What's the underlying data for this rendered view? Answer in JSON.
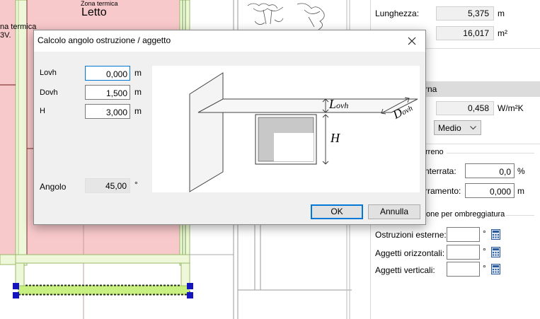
{
  "cad": {
    "zone_label": "Zona termica",
    "room_name": "Letto",
    "left_text_1": "na termica",
    "left_text_2": "3V."
  },
  "panel": {
    "lunghezza": {
      "label": "Lunghezza:",
      "value": "5,375",
      "unit": "m"
    },
    "area": {
      "value": "16,017",
      "unit": "m²"
    },
    "section_header": "rna",
    "trasmittanza": {
      "value": "0,458",
      "unit": "W/m²K"
    },
    "select_value": "Medio",
    "terreno_group": "rreno",
    "interrata": {
      "label": "nterrata:",
      "value": "0,0",
      "unit": "%"
    },
    "interramento": {
      "label": "rramento:",
      "value": "0,000",
      "unit": "m"
    },
    "ombreggiatura_group": "one per ombreggiatura",
    "ostruzioni": {
      "label": "Ostruzioni esterne:",
      "value": "",
      "unit": "°"
    },
    "aggetti_orizz": {
      "label": "Aggetti orizzontali:",
      "value": "",
      "unit": "°"
    },
    "aggetti_vert": {
      "label": "Aggetti verticali:",
      "value": "",
      "unit": "°"
    }
  },
  "dialog": {
    "title": "Calcolo angolo ostruzione / aggetto",
    "fields": [
      {
        "label": "Lovh",
        "value": "0,000",
        "unit": "m"
      },
      {
        "label": "Dovh",
        "value": "1,500",
        "unit": "m"
      },
      {
        "label": "H",
        "value": "3,000",
        "unit": "m"
      }
    ],
    "angle": {
      "label": "Angolo",
      "value": "45,00",
      "unit": "°"
    },
    "diagram": {
      "l_label": "L",
      "l_sub": "ovh",
      "d_label": "D",
      "d_sub": "ovh",
      "h_label": "H"
    },
    "ok_label": "OK",
    "cancel_label": "Annulla"
  },
  "colors": {
    "zone_fill": "#f8c9cb",
    "wall_fill": "#e8f5c8",
    "selected_wall": "#c8f080",
    "handle": "#1515c0"
  }
}
